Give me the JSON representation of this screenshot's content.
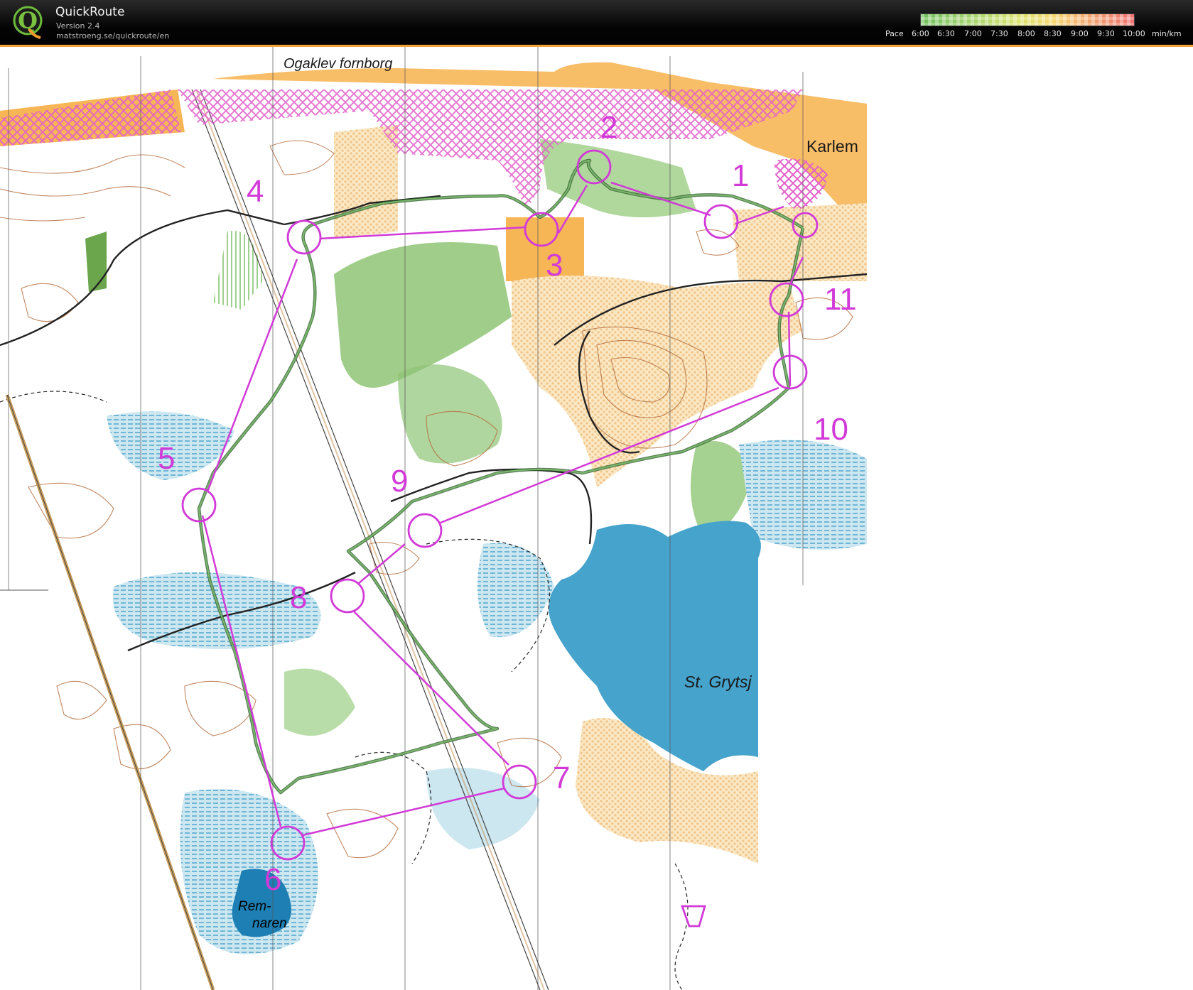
{
  "app": {
    "title": "QuickRoute",
    "version": "Version 2.4",
    "url": "matstroeng.se/quickroute/en",
    "logo_letter": "Q"
  },
  "pace_legend": {
    "label": "Pace",
    "ticks": [
      "6:00",
      "6:30",
      "7:00",
      "7:30",
      "8:00",
      "8:30",
      "9:00",
      "9:30",
      "10:00"
    ],
    "unit": "min/km"
  },
  "map": {
    "place_names": [
      "Ogaklev fornborg",
      "Karlem",
      "St. Grytsj",
      "Rem-",
      "naren"
    ],
    "controls": [
      "1",
      "2",
      "3",
      "4",
      "5",
      "6",
      "7",
      "8",
      "9",
      "10",
      "11"
    ],
    "colors": {
      "course": "#d23ad8",
      "route": "#3e7e3e",
      "water": "#46a3cc",
      "open_land": "#f7b656",
      "forest_green": "#8fc576",
      "contour": "#b4693a"
    }
  }
}
